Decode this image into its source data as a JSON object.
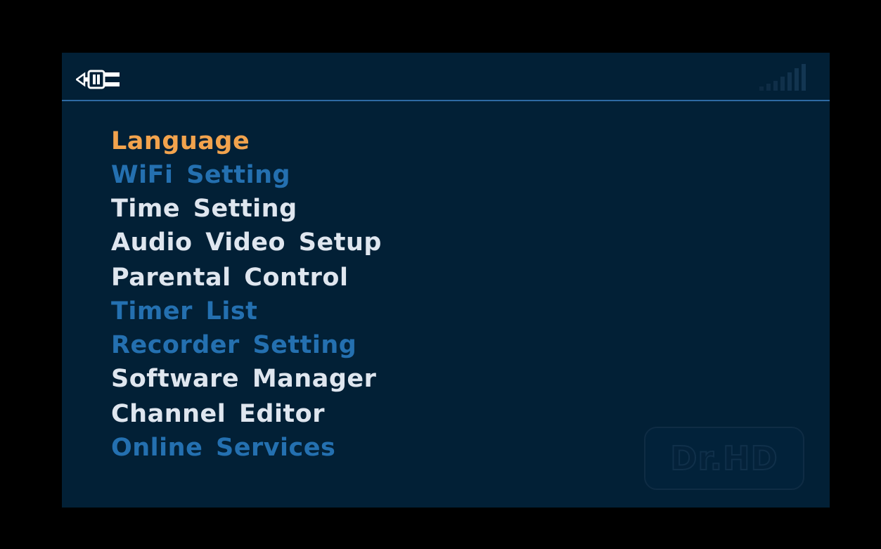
{
  "header": {
    "left_icon": "plug-icon",
    "right_icon": "signal-strength-icon"
  },
  "menu": {
    "items": [
      {
        "label": "Language",
        "state": "selected"
      },
      {
        "label": "WiFi Setting",
        "state": "disabled"
      },
      {
        "label": "Time Setting",
        "state": "enabled"
      },
      {
        "label": "Audio Video Setup",
        "state": "enabled"
      },
      {
        "label": "Parental Control",
        "state": "enabled"
      },
      {
        "label": "Timer List",
        "state": "disabled"
      },
      {
        "label": "Recorder Setting",
        "state": "disabled"
      },
      {
        "label": "Software Manager",
        "state": "enabled"
      },
      {
        "label": "Channel Editor",
        "state": "enabled"
      },
      {
        "label": "Online Services",
        "state": "disabled"
      }
    ]
  },
  "watermark": {
    "text": "Dr.HD"
  },
  "colors": {
    "background": "#000000",
    "panel": "#022036",
    "divider": "#2e6aa3",
    "selected": "#f2a34d",
    "enabled": "#dfe6ef",
    "disabled": "#2470b0"
  }
}
